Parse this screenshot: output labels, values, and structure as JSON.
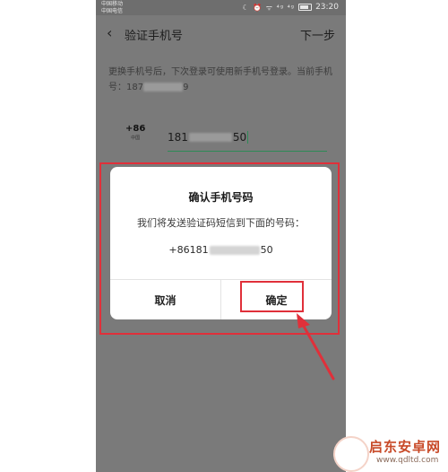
{
  "status_bar": {
    "carrier_1": "中国移动",
    "carrier_2": "中国电信",
    "icons": "☾ ⏰ ᯤ ⁴ᵍ ⁴ᵍ",
    "time": "23:20"
  },
  "nav": {
    "title": "验证手机号",
    "next_label": "下一步"
  },
  "info": {
    "line": "更换手机号后，下次登录可使用新手机号登录。当前手机号：",
    "number_prefix": "187",
    "number_suffix": "9"
  },
  "country": {
    "code": "+86",
    "name": "中国"
  },
  "phone_input": {
    "prefix": "181",
    "suffix": "50"
  },
  "dialog": {
    "title": "确认手机号码",
    "message": "我们将发送验证码短信到下面的号码：",
    "number_prefix": "+86181",
    "number_suffix": "50",
    "cancel_label": "取消",
    "confirm_label": "确定"
  },
  "watermark": {
    "brand": "启东安卓网",
    "url": "www.qdltd.com"
  },
  "colors": {
    "accent_green": "#2e8b57",
    "highlight_red": "#e0303a",
    "dim_overlay": "#7a7a7a"
  }
}
